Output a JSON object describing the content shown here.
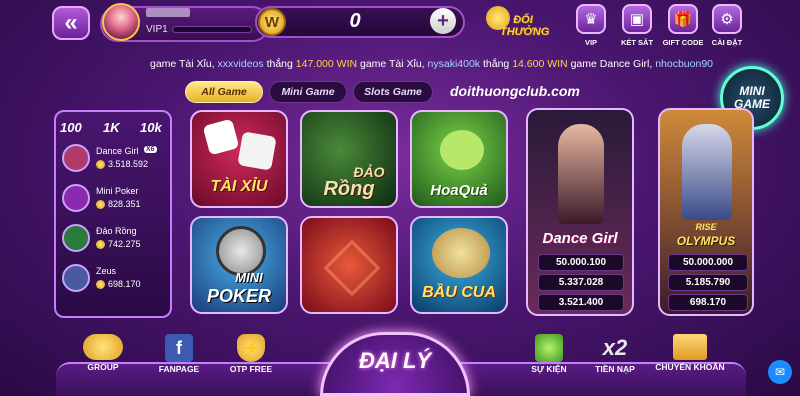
{
  "header": {
    "vip_label": "VIP1",
    "coin_symbol": "W",
    "coin_value": "0",
    "plus": "+",
    "doi_thuong": "ĐỔI THƯỞNG"
  },
  "top_icons": [
    {
      "label": "VIP",
      "glyph": "♛"
    },
    {
      "label": "KÉT SẮT",
      "glyph": "▣"
    },
    {
      "label": "GIFT CODE",
      "glyph": "🎁"
    },
    {
      "label": "CÀI ĐẶT",
      "glyph": "⚙"
    }
  ],
  "ticker": {
    "items": [
      {
        "prefix": "game",
        "game": "Tài Xỉu,",
        "user": "xxxvideos",
        "mid": "thắng",
        "amount": "147.000",
        "currency": "WIN"
      },
      {
        "prefix": "game",
        "game": "Tài Xỉu,",
        "user": "nysaki400k",
        "mid": "thắng",
        "amount": "14.600",
        "currency": "WIN"
      },
      {
        "prefix": "game",
        "game": "Dance Girl,",
        "user": "nhocbuon90",
        "mid": "",
        "amount": "",
        "currency": ""
      }
    ]
  },
  "tabs": [
    {
      "label": "All Game",
      "active": true
    },
    {
      "label": "Mini Game",
      "active": false
    },
    {
      "label": "Slots Game",
      "active": false
    }
  ],
  "site": "doithuongclub.com",
  "minigame": {
    "line1": "MINI",
    "line2": "GAME"
  },
  "jackpot": {
    "headers": [
      "100",
      "1K",
      "10k"
    ],
    "rows": [
      {
        "name": "Dance Girl",
        "value": "3.518.592",
        "badge": "X6",
        "color": "#b03a6a"
      },
      {
        "name": "Mini Poker",
        "value": "828.351",
        "badge": "",
        "color": "#8a2ab0"
      },
      {
        "name": "Đảo Rồng",
        "value": "742.275",
        "badge": "",
        "color": "#2a7a3a"
      },
      {
        "name": "Zeus",
        "value": "698.170",
        "badge": "",
        "color": "#4a5aa0"
      }
    ]
  },
  "games": {
    "tai_xiu": "TÀI XỈU",
    "dao_rong_1": "ĐẢO",
    "dao_rong_2": "Rồng",
    "hoa_qua": "HoaQuả",
    "mini_poker_1": "MINI",
    "mini_poker_2": "POKER",
    "bau_cua": "BẦU CUA",
    "dance_girl": "Dance Girl",
    "dance_girl_jp": [
      "50.000.100",
      "5.337.028",
      "3.521.400"
    ],
    "olympus_1": "RISE",
    "olympus_2": "OLYMPUS",
    "olympus_jp": [
      "50.000.000",
      "5.185.790",
      "698.170"
    ]
  },
  "bottom": {
    "items": [
      {
        "label": "GROUP"
      },
      {
        "label": "FANPAGE"
      },
      {
        "label": "OTP FREE"
      },
      {
        "label": "SỰ KIỆN"
      },
      {
        "label": "TIỀN NẠP"
      },
      {
        "label": "CHUYỂN KHOẢN"
      }
    ],
    "x2": "x2",
    "dai_ly": "ĐẠI LÝ"
  }
}
